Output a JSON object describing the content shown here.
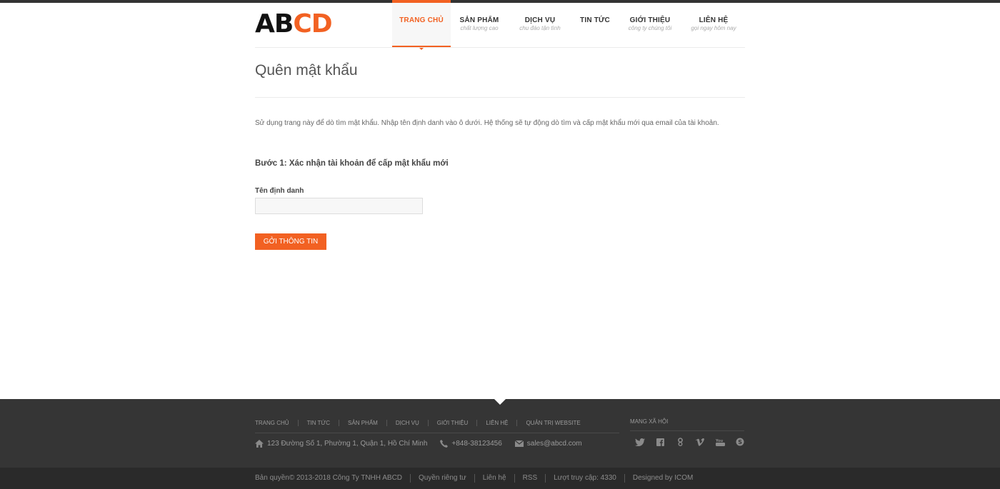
{
  "brand": {
    "part1": "AB",
    "part2": "CD",
    "accent": "#f26122"
  },
  "nav": {
    "items": [
      {
        "title": "TRANG CHỦ",
        "sub": "",
        "active": true
      },
      {
        "title": "SẢN PHẨM",
        "sub": "chất lượng cao"
      },
      {
        "title": "DỊCH VỤ",
        "sub": "chu đáo tận tình"
      },
      {
        "title": "TIN TỨC",
        "sub": ""
      },
      {
        "title": "GIỚI THIỆU",
        "sub": "công ty chúng tôi"
      },
      {
        "title": "LIÊN HỆ",
        "sub": "gọi ngay hôm nay"
      }
    ]
  },
  "page": {
    "title": "Quên mật khẩu",
    "intro": "Sử dụng trang này để dò tìm mật khẩu. Nhập tên định danh vào ô dưới. Hệ thống sẽ tự động dò tìm và cấp mật khẩu mới qua email của tài khoản.",
    "step": "Bước 1: Xác nhận tài khoản để cấp mật khẩu mới",
    "field_label": "Tên định danh",
    "field_value": "",
    "submit": "GỞI THÔNG TIN"
  },
  "footer": {
    "links": [
      "TRANG CHỦ",
      "TIN TỨC",
      "SẢN PHẨM",
      "DỊCH VỤ",
      "GIỚI THIỆU",
      "LIÊN HỆ",
      "QUẢN TRỊ WEBSITE"
    ],
    "address": "123 Đường Số 1, Phường 1, Quận 1, Hồ Chí Minh",
    "phone": "+848-38123456",
    "email": "sales@abcd.com",
    "social_title": "MANG XÃ HỘI",
    "social_icons": [
      "twitter-icon",
      "facebook-icon",
      "google-plus-icon",
      "vimeo-icon",
      "youtube-icon",
      "skype-icon"
    ]
  },
  "bottom": {
    "copyright": "Bản quyền© 2013-2018 Công Ty TNHH ABCD",
    "privacy": "Quyền riêng tư",
    "contact": "Liên hệ",
    "rss": "RSS",
    "visits": "Lượt truy cập: 4330",
    "designed": "Designed by ICOM"
  }
}
